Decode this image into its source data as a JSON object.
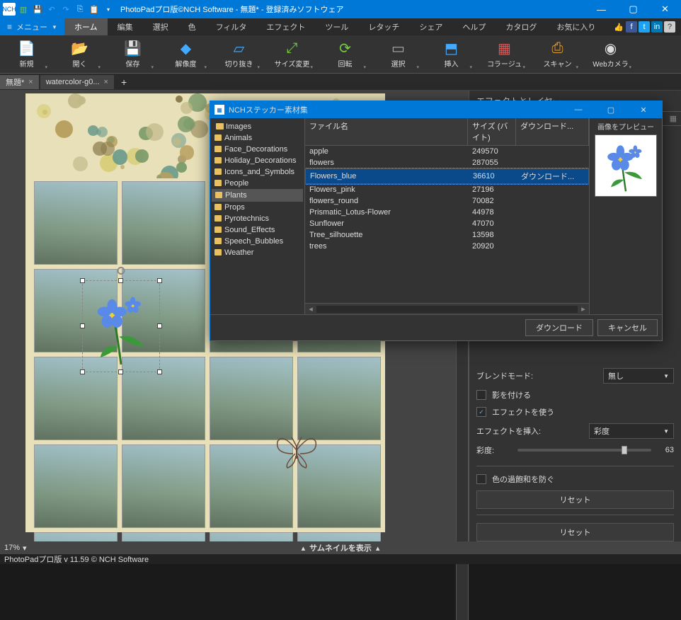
{
  "app": {
    "title": "PhotoPadプロ版©NCH Software - 無題* - 登録済みソフトウェア"
  },
  "menu": {
    "button": "メニュー",
    "tabs": [
      "ホーム",
      "編集",
      "選択",
      "色",
      "フィルタ",
      "エフェクト",
      "ツール",
      "レタッチ",
      "シェア",
      "ヘルプ",
      "カタログ",
      "お気に入り"
    ]
  },
  "toolbar": [
    {
      "id": "new",
      "label": "新規",
      "glyph": "📄",
      "color": "#7c4"
    },
    {
      "id": "open",
      "label": "開く",
      "glyph": "📂",
      "color": "#e8a030"
    },
    {
      "id": "save",
      "label": "保存",
      "glyph": "💾",
      "color": "#4af"
    },
    {
      "id": "res",
      "label": "解像度",
      "glyph": "◆",
      "color": "#4af"
    },
    {
      "id": "crop",
      "label": "切り抜き",
      "glyph": "▱",
      "color": "#4af"
    },
    {
      "id": "resize",
      "label": "サイズ変更",
      "glyph": "⤢",
      "color": "#7c4"
    },
    {
      "id": "rotate",
      "label": "回転",
      "glyph": "⟳",
      "color": "#7c4"
    },
    {
      "id": "select",
      "label": "選択",
      "glyph": "▭",
      "color": "#aaa"
    },
    {
      "id": "insert",
      "label": "挿入",
      "glyph": "⬒",
      "color": "#4af"
    },
    {
      "id": "collage",
      "label": "コラージュ",
      "glyph": "▦",
      "color": "#d55"
    },
    {
      "id": "scan",
      "label": "スキャン",
      "glyph": "⎙",
      "color": "#e8a030"
    },
    {
      "id": "webcam",
      "label": "Webカメラ",
      "glyph": "◉",
      "color": "#ddd"
    }
  ],
  "doctabs": [
    {
      "label": "無題*",
      "active": true
    },
    {
      "label": "watercolor-g0...",
      "active": false
    }
  ],
  "sidebar": {
    "header": "エフェクトとレイヤー",
    "blend_label": "ブレンドモード:",
    "blend_value": "無し",
    "shadow": "影を付ける",
    "use_effect": "エフェクトを使う",
    "use_effect_checked": true,
    "insert_label": "エフェクトを挿入:",
    "insert_value": "彩度",
    "sat_label": "彩度:",
    "sat_value": "63",
    "oversat": "色の過飽和を防ぐ",
    "reset": "リセット"
  },
  "status": {
    "zoom": "17%",
    "thumb": "サムネイルを表示"
  },
  "footer": "PhotoPadプロ版 v 11.59 © NCH Software",
  "modal": {
    "title": "NCHステッカー素材集",
    "tree_root": "Images",
    "tree": [
      "Animals",
      "Face_Decorations",
      "Holiday_Decorations",
      "Icons_and_Symbols",
      "People",
      "Plants",
      "Props",
      "Pyrotechnics",
      "Sound_Effects",
      "Speech_Bubbles",
      "Weather"
    ],
    "tree_sel": "Plants",
    "cols": {
      "name": "ファイル名",
      "size": "サイズ (バイト)",
      "dl": "ダウンロード..."
    },
    "rows": [
      {
        "name": "apple",
        "size": "249570",
        "dl": ""
      },
      {
        "name": "flowers",
        "size": "287055",
        "dl": ""
      },
      {
        "name": "Flowers_blue",
        "size": "36610",
        "dl": "ダウンロード..."
      },
      {
        "name": "Flowers_pink",
        "size": "27196",
        "dl": ""
      },
      {
        "name": "flowers_round",
        "size": "70082",
        "dl": ""
      },
      {
        "name": "Prismatic_Lotus-Flower",
        "size": "44978",
        "dl": ""
      },
      {
        "name": "Sunflower",
        "size": "47070",
        "dl": ""
      },
      {
        "name": "Tree_silhouette",
        "size": "13598",
        "dl": ""
      },
      {
        "name": "trees",
        "size": "20920",
        "dl": ""
      }
    ],
    "sel_row": "Flowers_blue",
    "preview_label": "画像をプレビュー",
    "btn_download": "ダウンロード",
    "btn_cancel": "キャンセル"
  }
}
